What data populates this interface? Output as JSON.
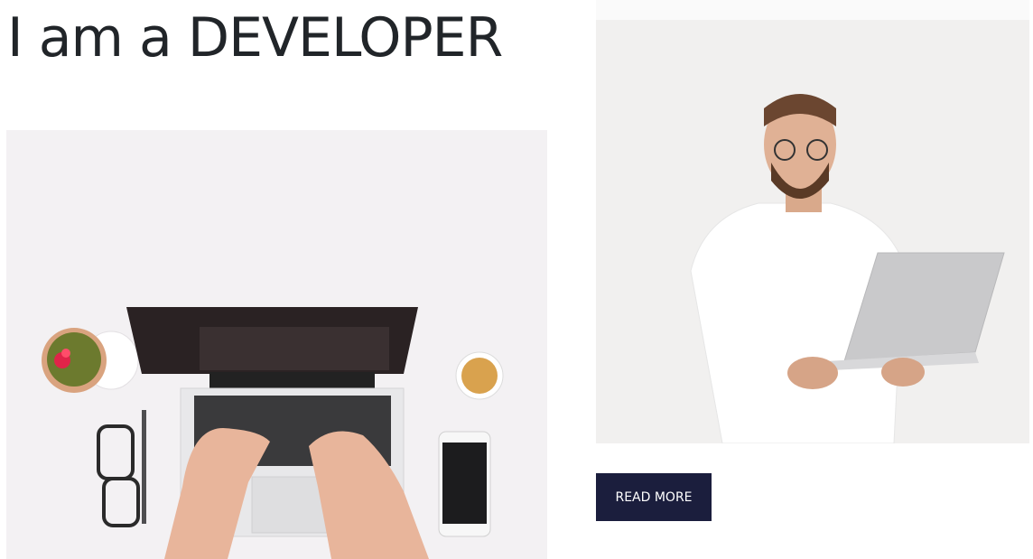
{
  "hero": {
    "headline": "I am a DEVELOPER",
    "read_more_label": "READ MORE"
  },
  "images": {
    "left": "workspace-laptop-photo",
    "right": "developer-portrait-photo"
  },
  "colors": {
    "text": "#212529",
    "button_bg": "#1b1e3d",
    "button_text": "#ffffff"
  }
}
